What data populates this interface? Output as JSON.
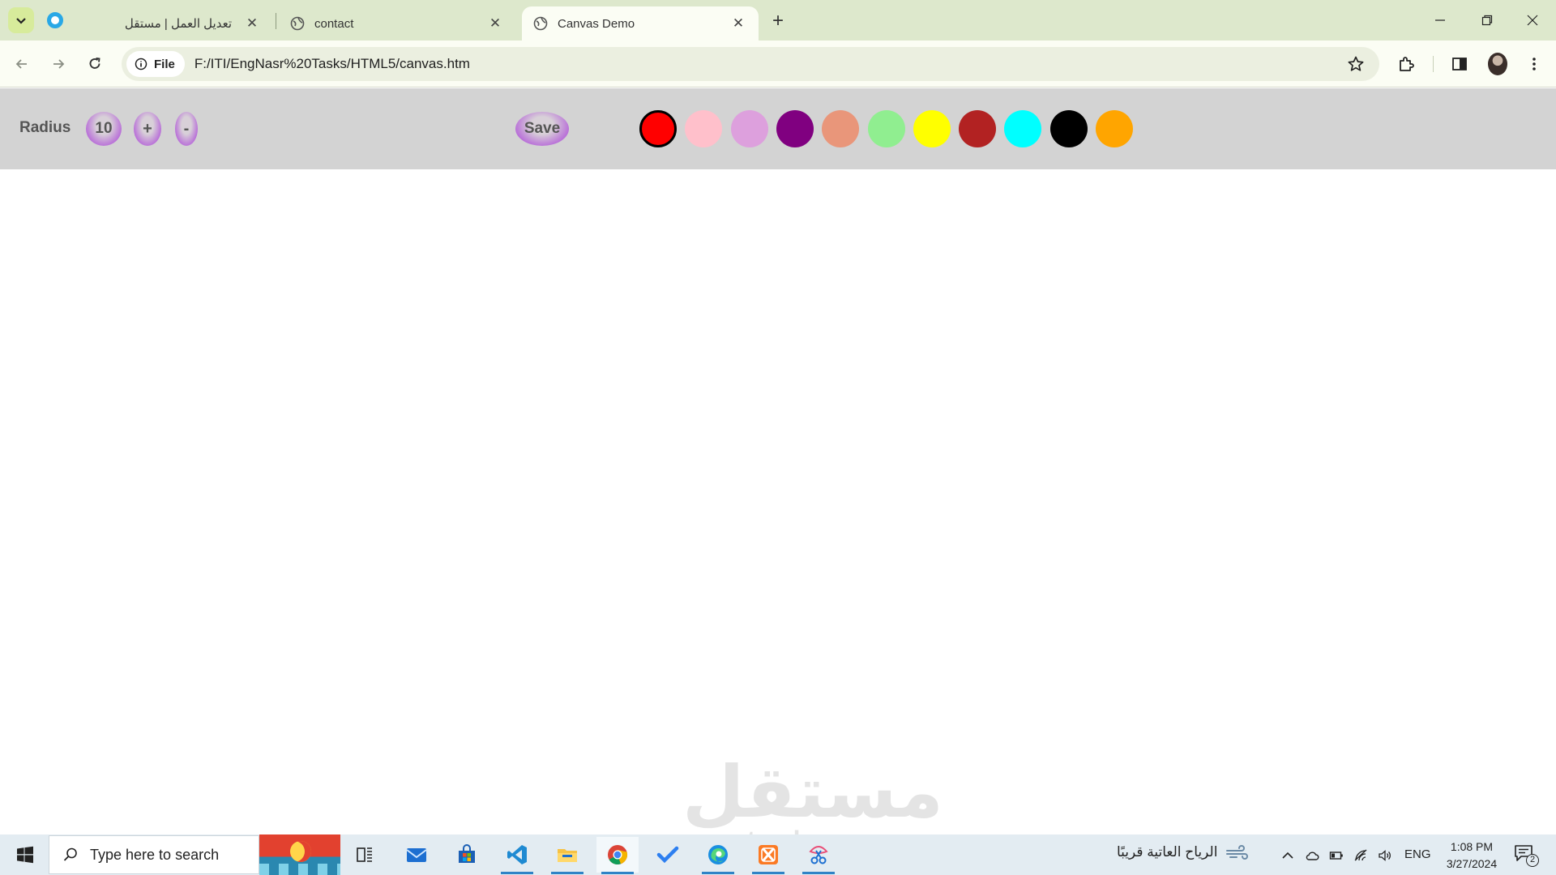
{
  "browser": {
    "tabs": [
      {
        "title": "تعديل العمل | مستقل",
        "active": false
      },
      {
        "title": "contact",
        "active": false
      },
      {
        "title": "Canvas Demo",
        "active": true
      }
    ],
    "close_glyph": "✕",
    "new_tab_glyph": "+",
    "address": {
      "chip_label": "File",
      "url": "F:/ITI/EngNasr%20Tasks/HTML5/canvas.htm"
    }
  },
  "page": {
    "radius_label": "Radius",
    "radius_value": "10",
    "plus_label": "+",
    "minus_label": "-",
    "save_label": "Save",
    "selected_color": "#ff0000",
    "colors": [
      "#ff0000",
      "#ffc0cb",
      "#dda0dd",
      "#800080",
      "#e9967a",
      "#90ee90",
      "#ffff00",
      "#b22222",
      "#00ffff",
      "#000000",
      "#ffa500"
    ]
  },
  "watermark": {
    "arabic": "مستقل",
    "latin": "mostaql.com"
  },
  "taskbar": {
    "search_placeholder": "Type here to search",
    "weather_text": "الرياح العاتية قريبًا",
    "language": "ENG",
    "time": "1:08 PM",
    "date": "3/27/2024",
    "notification_count": "2"
  }
}
